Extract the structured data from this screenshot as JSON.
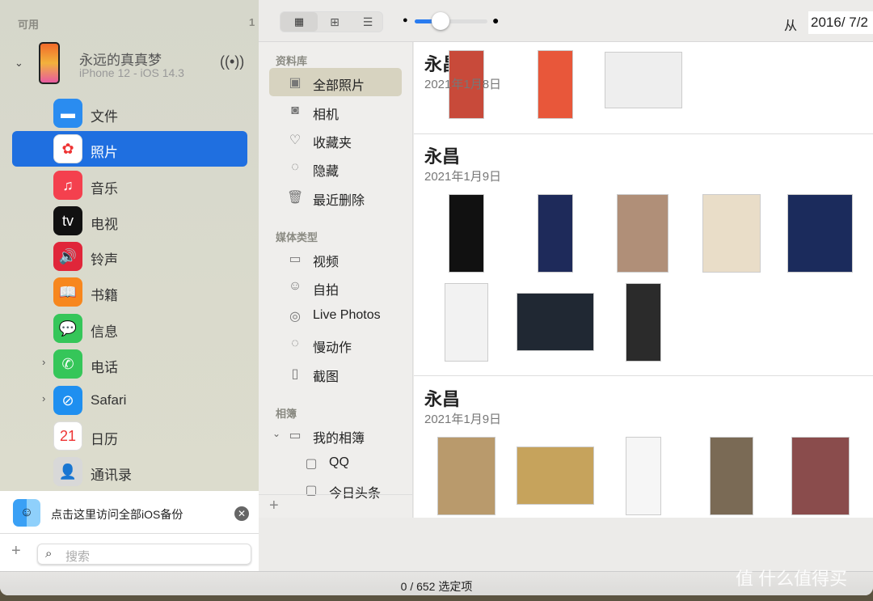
{
  "sidebar": {
    "section_label": "可用",
    "count": "1",
    "device": {
      "name": "永远的真真梦",
      "model": "iPhone 12 - iOS 14.3"
    },
    "items": [
      {
        "label": "文件",
        "icon": "files-icon",
        "color": "#2a8cf0",
        "glyph": "▬",
        "chev": ""
      },
      {
        "label": "照片",
        "icon": "photos-icon",
        "color": "#ffffff",
        "glyph": "✿",
        "chev": "",
        "selected": true
      },
      {
        "label": "音乐",
        "icon": "music-icon",
        "color": "#f4404e",
        "glyph": "♫",
        "chev": ""
      },
      {
        "label": "电视",
        "icon": "tv-icon",
        "color": "#111111",
        "glyph": "tv",
        "chev": ""
      },
      {
        "label": "铃声",
        "icon": "ringtone-icon",
        "color": "#e0263a",
        "glyph": "🔊",
        "chev": ""
      },
      {
        "label": "书籍",
        "icon": "books-icon",
        "color": "#f7871e",
        "glyph": "📖",
        "chev": ""
      },
      {
        "label": "信息",
        "icon": "messages-icon",
        "color": "#35c659",
        "glyph": "💬",
        "chev": ""
      },
      {
        "label": "电话",
        "icon": "phone-icon",
        "color": "#35c659",
        "glyph": "✆",
        "chev": "›"
      },
      {
        "label": "Safari",
        "icon": "safari-icon",
        "color": "#1e8ff0",
        "glyph": "⊘",
        "chev": "›"
      },
      {
        "label": "日历",
        "icon": "calendar-icon",
        "color": "#ffffff",
        "glyph": "21",
        "chev": ""
      },
      {
        "label": "通讯录",
        "icon": "contacts-icon",
        "color": "#d8d8d8",
        "glyph": "👤",
        "chev": ""
      }
    ],
    "banner": "点击这里访问全部iOS备份",
    "search_placeholder": "搜索"
  },
  "toolbar": {
    "from_label": "从",
    "date_value": "2016/  7/2",
    "zoom_level": 0.35
  },
  "library": {
    "header": "资料库",
    "items": [
      {
        "label": "全部照片",
        "icon": "photo-library-icon",
        "glyph": "▣",
        "selected": true
      },
      {
        "label": "相机",
        "icon": "camera-icon",
        "glyph": "◙"
      },
      {
        "label": "收藏夹",
        "icon": "heart-icon",
        "glyph": "♡"
      },
      {
        "label": "隐藏",
        "icon": "hidden-eye-icon",
        "glyph": "◌"
      },
      {
        "label": "最近删除",
        "icon": "trash-icon",
        "glyph": "🗑"
      }
    ],
    "media_header": "媒体类型",
    "media": [
      {
        "label": "视频",
        "icon": "video-icon",
        "glyph": "▭"
      },
      {
        "label": "自拍",
        "icon": "selfie-icon",
        "glyph": "☺"
      },
      {
        "label": "Live Photos",
        "icon": "live-photos-icon",
        "glyph": "◎"
      },
      {
        "label": "慢动作",
        "icon": "slow-mo-icon",
        "glyph": "◌"
      },
      {
        "label": "截图",
        "icon": "screenshot-icon",
        "glyph": "▯"
      }
    ],
    "albums_header": "相簿",
    "albums": [
      {
        "label": "我的相簿",
        "icon": "album-folder-icon",
        "glyph": "▭"
      },
      {
        "label": "QQ",
        "icon": "album-icon",
        "glyph": "▢"
      },
      {
        "label": "今日头条",
        "icon": "album-icon",
        "glyph": "▢"
      }
    ]
  },
  "sections": [
    {
      "title": "永昌",
      "date": "2021年1月8日",
      "photos": [
        "#c84a3a",
        "#e8573a",
        "#eeeeee"
      ]
    },
    {
      "title": "永昌",
      "date": "2021年1月9日",
      "photos": [
        "#111111",
        "#1e2a5a",
        "#b08f78",
        "#e9ddc8",
        "#1b2b5c",
        "#f2f2f2",
        "#202833",
        "#2b2b2b"
      ]
    },
    {
      "title": "永昌",
      "date": "2021年1月9日",
      "photos": [
        "#b99a6c",
        "#c6a35c",
        "#f6f6f6",
        "#7a6a55",
        "#8a4c4c"
      ]
    }
  ],
  "status": "0 / 652 选定项",
  "watermark": "值 什么值得买"
}
